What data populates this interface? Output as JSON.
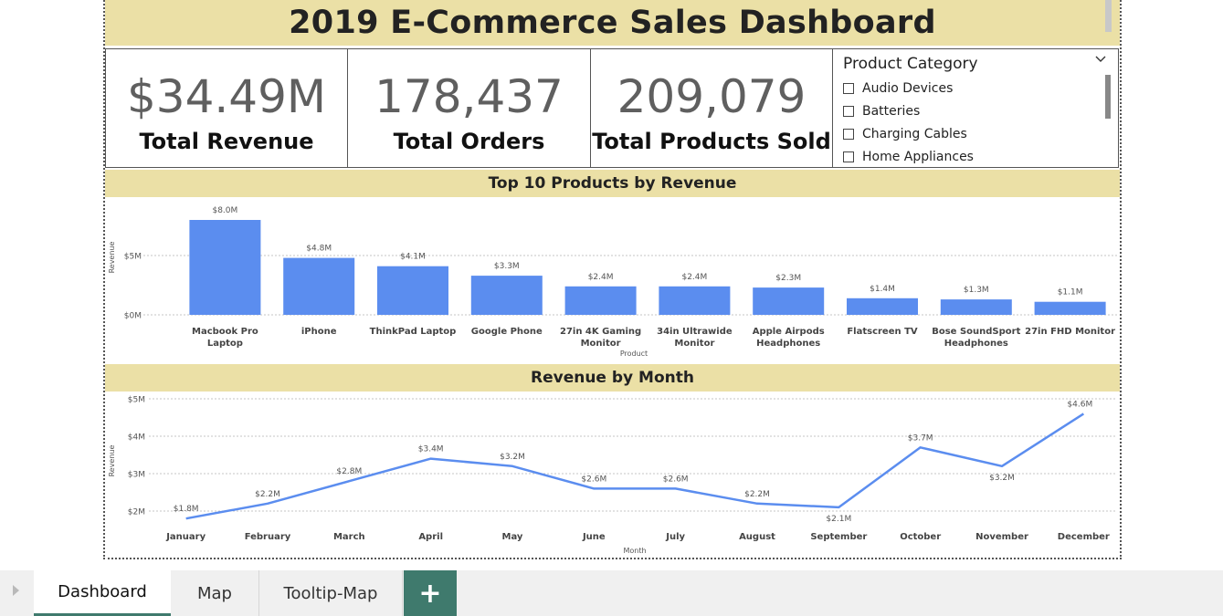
{
  "dashboard": {
    "title": "2019 E-Commerce Sales Dashboard"
  },
  "kpis": [
    {
      "value": "$34.49M",
      "label": "Total Revenue"
    },
    {
      "value": "178,437",
      "label": "Total Orders"
    },
    {
      "value": "209,079",
      "label": "Total Products Sold"
    }
  ],
  "slicer": {
    "title": "Product Category",
    "options": [
      "Audio Devices",
      "Batteries",
      "Charging Cables",
      "Home Appliances"
    ]
  },
  "bar_section": {
    "title": "Top 10 Products by Revenue"
  },
  "line_section": {
    "title": "Revenue by Month"
  },
  "tabs": {
    "items": [
      "Dashboard",
      "Map",
      "Tooltip-Map"
    ],
    "active": "Dashboard",
    "add_label": "+"
  },
  "colors": {
    "accent_band": "#ebe0a6",
    "series": "#5b8def",
    "tab_accent": "#3f7a6d"
  },
  "icons": {
    "slicer_toggle": "chevron-down-icon",
    "add_page": "plus-icon",
    "tab_nav": "chevron-right-icon"
  },
  "chart_data": [
    {
      "type": "bar",
      "title": "Top 10 Products by Revenue",
      "xlabel": "Product",
      "ylabel": "Revenue",
      "yticks": [
        "$0M",
        "$5M"
      ],
      "ylim": [
        0,
        10
      ],
      "grid": true,
      "categories": [
        "Macbook Pro Laptop",
        "iPhone",
        "ThinkPad Laptop",
        "Google Phone",
        "27in 4K Gaming Monitor",
        "34in Ultrawide Monitor",
        "Apple Airpods Headphones",
        "Flatscreen TV",
        "Bose SoundSport Headphones",
        "27in FHD Monitor"
      ],
      "values": [
        8.0,
        4.8,
        4.1,
        3.3,
        2.4,
        2.4,
        2.3,
        1.4,
        1.3,
        1.1
      ],
      "data_labels": [
        "$8.0M",
        "$4.8M",
        "$4.1M",
        "$3.3M",
        "$2.4M",
        "$2.4M",
        "$2.3M",
        "$1.4M",
        "$1.3M",
        "$1.1M"
      ]
    },
    {
      "type": "line",
      "title": "Revenue by Month",
      "xlabel": "Month",
      "ylabel": "Revenue",
      "yticks": [
        "$2M",
        "$3M",
        "$4M",
        "$5M"
      ],
      "ylim": [
        2,
        5
      ],
      "grid": true,
      "categories": [
        "January",
        "February",
        "March",
        "April",
        "May",
        "June",
        "July",
        "August",
        "September",
        "October",
        "November",
        "December"
      ],
      "values": [
        1.8,
        2.2,
        2.8,
        3.4,
        3.2,
        2.6,
        2.6,
        2.2,
        2.1,
        3.7,
        3.2,
        4.6
      ],
      "data_labels": [
        "$1.8M",
        "$2.2M",
        "$2.8M",
        "$3.4M",
        "$3.2M",
        "$2.6M",
        "$2.6M",
        "$2.2M",
        "$2.1M",
        "$3.7M",
        "$3.2M",
        "$4.6M"
      ]
    }
  ]
}
